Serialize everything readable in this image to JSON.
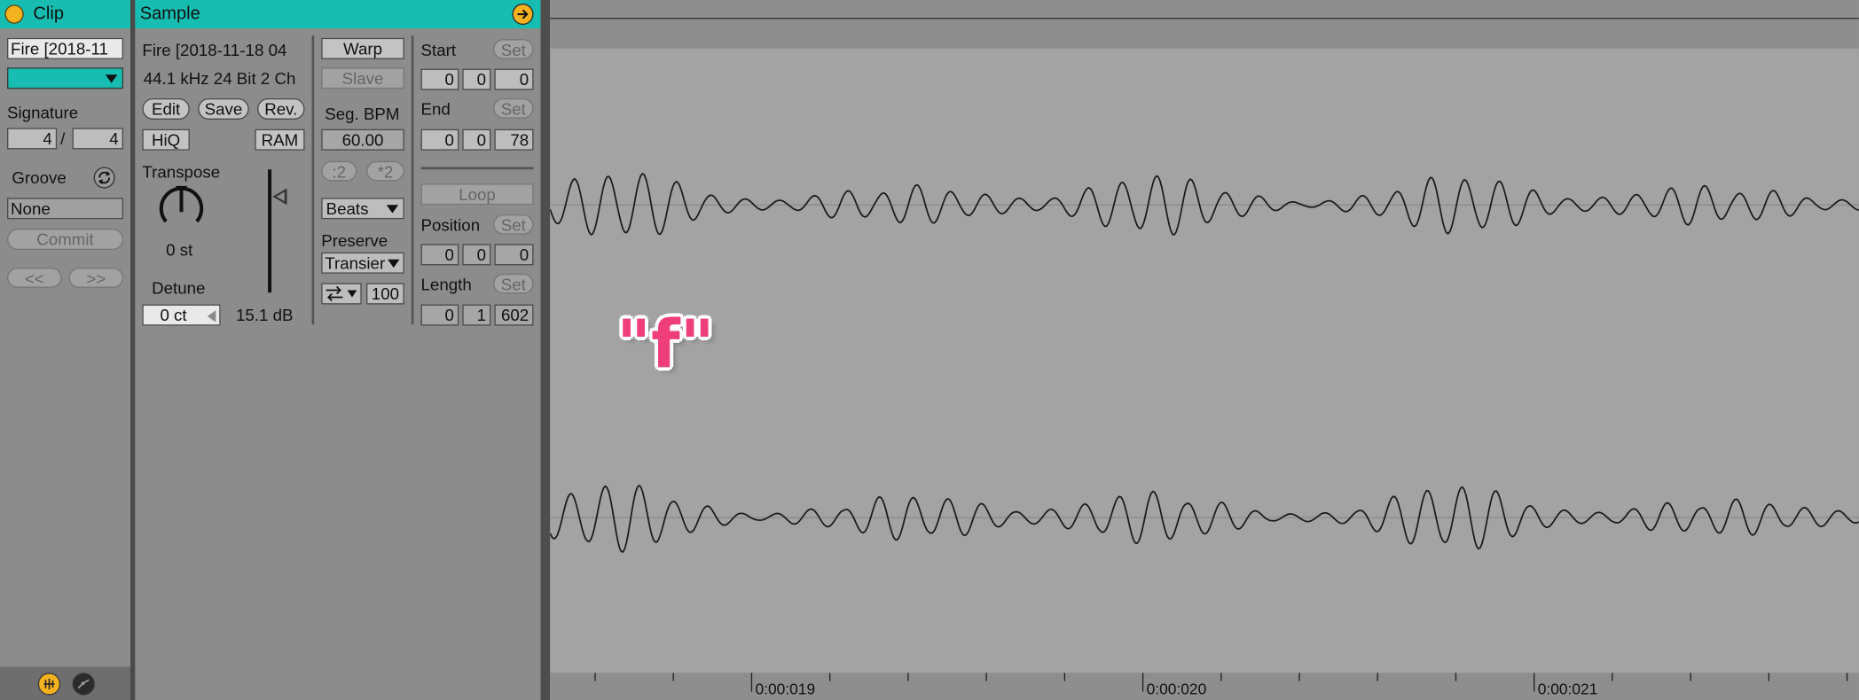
{
  "clip_panel": {
    "title": "Clip",
    "clip_name": "Fire [2018-11",
    "signature_label": "Signature",
    "sig_numerator": "4",
    "sig_slash": "/",
    "sig_denominator": "4",
    "groove_label": "Groove",
    "groove_value": "None",
    "commit_label": "Commit",
    "prev_label": "<<",
    "next_label": ">>"
  },
  "sample_panel": {
    "title": "Sample",
    "file_name": "Fire [2018-11-18 04",
    "file_info": "44.1 kHz 24 Bit 2 Ch",
    "edit_label": "Edit",
    "save_label": "Save",
    "rev_label": "Rev.",
    "hiq_label": "HiQ",
    "ram_label": "RAM",
    "transpose_label": "Transpose",
    "transpose_value": "0 st",
    "detune_label": "Detune",
    "detune_value": "0 ct",
    "gain_value": "15.1 dB",
    "warp_label": "Warp",
    "slave_label": "Slave",
    "seg_bpm_label": "Seg. BPM",
    "seg_bpm_value": "60.00",
    "half_label": ":2",
    "double_label": "*2",
    "warp_mode": "Beats",
    "preserve_label": "Preserve",
    "preserve_value": "Transier",
    "loop_mode_value": "100",
    "start_label": "Start",
    "start_values": [
      "0",
      "0",
      "0"
    ],
    "end_label": "End",
    "end_values": [
      "0",
      "0",
      "78"
    ],
    "loop_label": "Loop",
    "position_label": "Position",
    "position_values": [
      "0",
      "0",
      "0"
    ],
    "length_label": "Length",
    "length_values": [
      "0",
      "1",
      "602"
    ],
    "set_label": "Set"
  },
  "waveform": {
    "annotation": "\"f\"",
    "timeline_labels": [
      "0:00:019",
      "0:00:020",
      "0:00:021"
    ]
  },
  "colors": {
    "accent": "#16bdb0",
    "launch": "#f5b21f",
    "annotation": "#f03d7c"
  }
}
